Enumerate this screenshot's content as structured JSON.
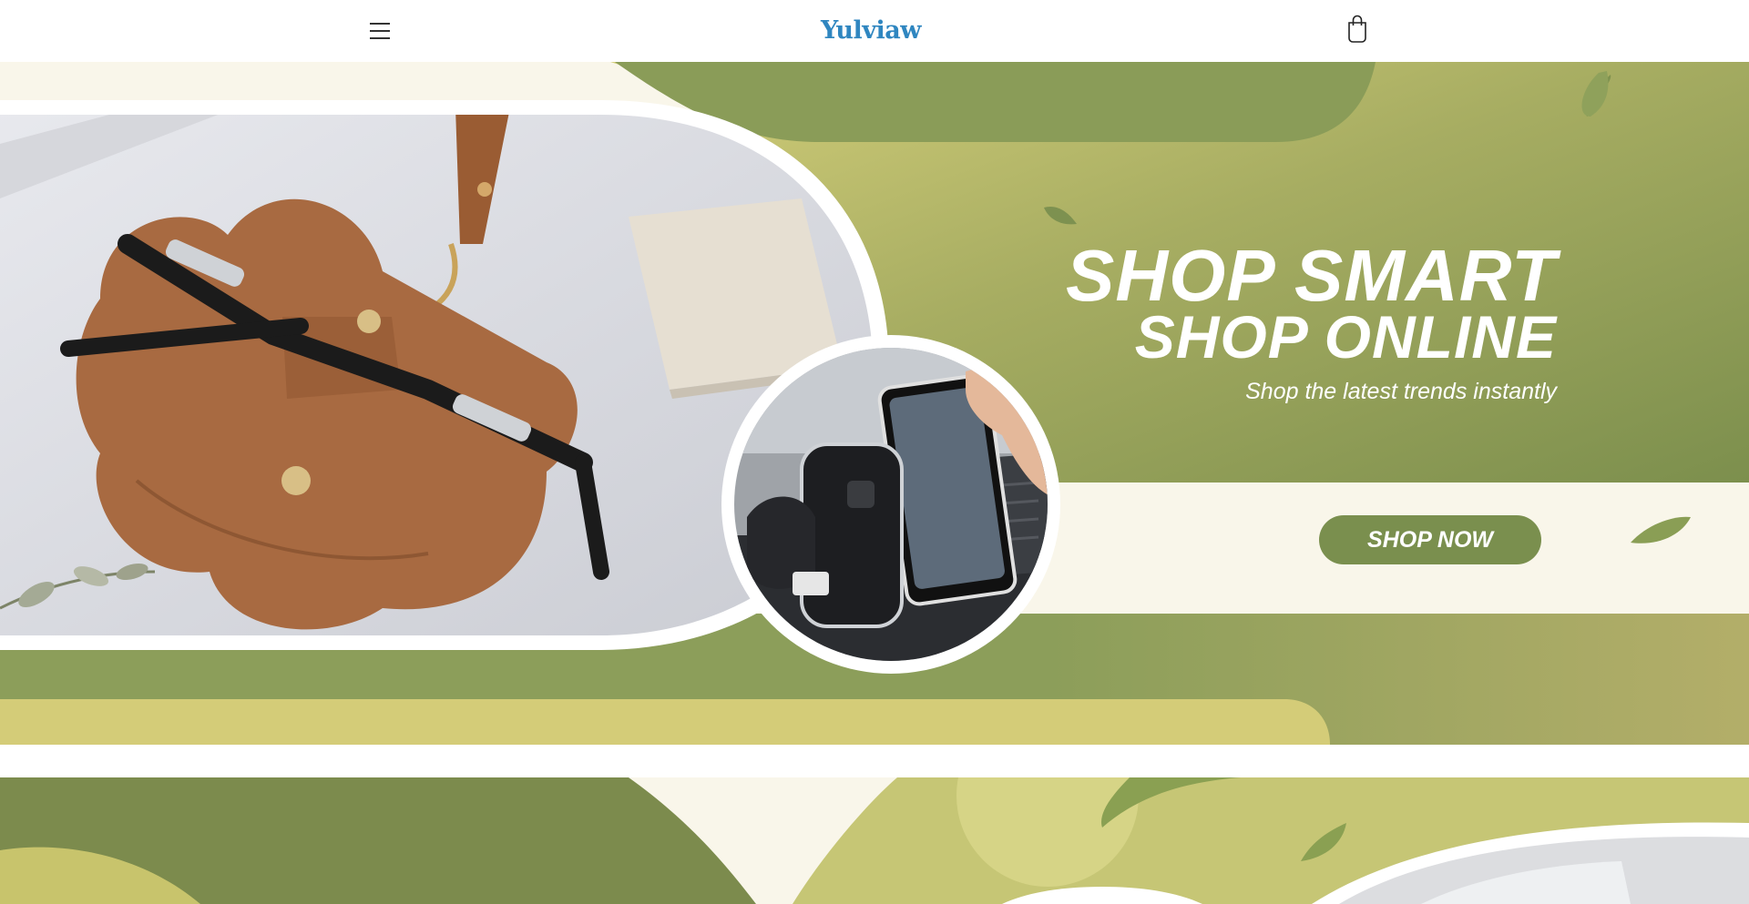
{
  "header": {
    "brand": "Yulviaw",
    "menu_icon": "hamburger-menu-icon",
    "cart_icon": "shopping-bag-icon"
  },
  "hero": {
    "title_line1": "SHOP SMART",
    "title_line2": "SHOP ONLINE",
    "subtitle": "Shop the latest trends instantly",
    "cta_label": "SHOP NOW",
    "images": [
      "leather-glasses-case-photo",
      "car-phone-mount-photo"
    ]
  },
  "colors": {
    "brand_blue": "#2f86c0",
    "olive_dark": "#7a8f4e",
    "olive_mid": "#8c9e5a",
    "lime": "#c8c86e",
    "cream": "#f9f6ea",
    "sand": "#d4cc78"
  }
}
